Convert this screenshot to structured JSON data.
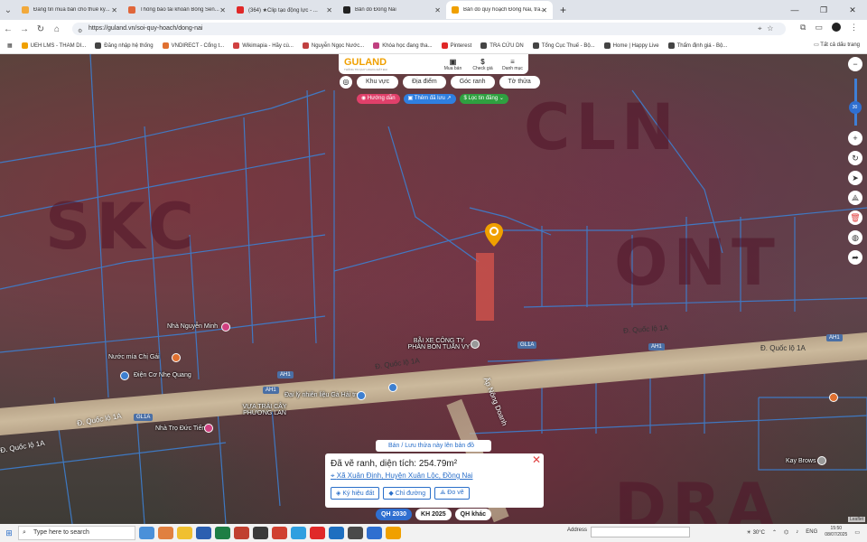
{
  "browser": {
    "tabs": [
      {
        "label": "Đăng tin mua bán cho thuê ký...",
        "color": "#f2a93b"
      },
      {
        "label": "Thông báo tài khoản Bông Sen...",
        "color": "#e0663a"
      },
      {
        "label": "(364) ★Clip tạo động lực - ...",
        "color": "#e02828"
      },
      {
        "label": "Bản đồ Đồng Nai",
        "color": "#222222"
      },
      {
        "label": "Bản đồ quy hoạch Đồng Nai, tra...",
        "color": "#f0a000",
        "active": true
      }
    ],
    "new_tab": "+",
    "url": "https://guland.vn/soi-quy-hoach/dong-nai",
    "bookmarks": [
      {
        "label": "UEH LMS - THAM DI...",
        "color": "#f0a000"
      },
      {
        "label": "Đăng nhập hệ thống",
        "color": "#444"
      },
      {
        "label": "VNDIRECT - Cổng t...",
        "color": "#e07030"
      },
      {
        "label": "Wikimapia - Hãy cù...",
        "color": "#d04040"
      },
      {
        "label": "Nguyễn Ngọc Nước...",
        "color": "#c04040"
      },
      {
        "label": "Khóa học đang tha...",
        "color": "#c04080"
      },
      {
        "label": "Pinterest",
        "color": "#e02828"
      },
      {
        "label": "TRA CỨU DN",
        "color": "#444"
      },
      {
        "label": "Tổng Cục Thuế - Bộ...",
        "color": "#444"
      },
      {
        "label": "Home | Happy Live",
        "color": "#444"
      },
      {
        "label": "Thẩm định giá - Bộ...",
        "color": "#444"
      }
    ],
    "all_bookmarks": "Tất cả dấu trang"
  },
  "guland": {
    "logo": "GULAND",
    "logo_tagline": "THÔNG TIN QUY HOẠCH ĐẤT ĐAI",
    "buttons": [
      {
        "icon": "▣",
        "label": "Mua bán"
      },
      {
        "icon": "$",
        "label": "Check giá"
      },
      {
        "icon": "≡",
        "label": "Danh mục"
      }
    ],
    "chips": [
      "Khu vực",
      "Địa điểm",
      "Góc ranh",
      "Tờ thửa"
    ],
    "pills": [
      {
        "label": "◉ Hướng dẫn",
        "color": "#e0406a"
      },
      {
        "label": "▣ Thêm đã lưu ↗",
        "color": "#2f7fe0"
      },
      {
        "label": "$ Lọc tin đăng ⌄",
        "color": "#2fa040"
      }
    ]
  },
  "map": {
    "zones": [
      "SKC",
      "CLN",
      "ONT",
      "DRA"
    ],
    "places": [
      {
        "label": "Nhà Nguyễn Minh"
      },
      {
        "label": "Nước mía Chị Gái"
      },
      {
        "label": "Điện Cơ Nhẹ Quang"
      },
      {
        "label": "BÃI XE CÔNG TY PHÂN BÓN TUẤN VY"
      },
      {
        "label": "Đại lý nhiên liệu Gà Hải trụ"
      },
      {
        "label": "VỰA TRÁI CÂY PHƯƠNG LAN"
      },
      {
        "label": "Nhà Trọ Đức Tiến"
      },
      {
        "label": "Kay Brows"
      }
    ],
    "road_names": [
      "Đ. Quốc lộ 1A",
      "Đ. Quốc lộ 1A",
      "Đ. Quốc lộ 1A",
      "Đ. Quốc lộ 1A",
      "Ấp Nông Doanh"
    ],
    "shields": [
      "GL1A",
      "AH1",
      "AH1",
      "AH1",
      "GL1A",
      "AH1"
    ],
    "zoom": "30"
  },
  "popup": {
    "save_banner": "Bán / Lưu thửa này lên bản đồ",
    "title": "Đã vẽ ranh, diện tích: 254.79m²",
    "address": "Xã Xuân Định, Huyện Xuân Lộc, Đồng Nai",
    "buttons": [
      "Ký hiệu đất",
      "Chỉ đường",
      "Đo vẽ"
    ]
  },
  "plan_tabs": [
    {
      "label": "QH 2030",
      "active": true
    },
    {
      "label": "KH 2025",
      "active": false
    },
    {
      "label": "QH khác",
      "active": false
    }
  ],
  "attribution": "Leaflet",
  "taskbar": {
    "search_placeholder": "Type here to search",
    "address_label": "Address",
    "weather": "30°C",
    "lang": "ENG",
    "time": "15:50",
    "date": "08/07/2025"
  }
}
